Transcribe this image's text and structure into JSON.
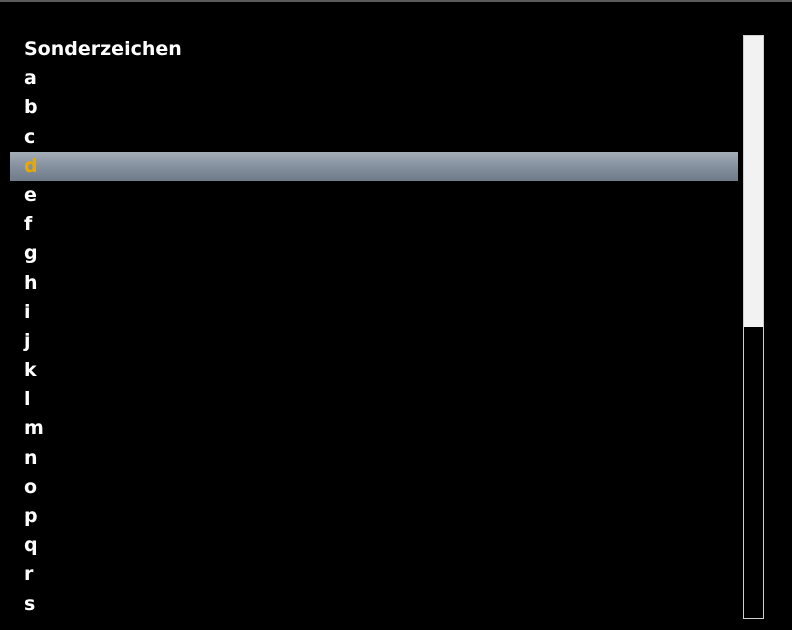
{
  "list": {
    "items": [
      {
        "label": "Sonderzeichen"
      },
      {
        "label": "a"
      },
      {
        "label": "b"
      },
      {
        "label": "c"
      },
      {
        "label": "d"
      },
      {
        "label": "e"
      },
      {
        "label": "f"
      },
      {
        "label": "g"
      },
      {
        "label": "h"
      },
      {
        "label": "i"
      },
      {
        "label": "j"
      },
      {
        "label": "k"
      },
      {
        "label": "l"
      },
      {
        "label": "m"
      },
      {
        "label": "n"
      },
      {
        "label": "o"
      },
      {
        "label": "p"
      },
      {
        "label": "q"
      },
      {
        "label": "r"
      },
      {
        "label": "s"
      }
    ],
    "selected_index": 4
  },
  "scrollbar": {
    "visible_fraction": 0.5,
    "scroll_position": 0
  },
  "colors": {
    "background": "#000000",
    "text": "#ffffff",
    "selected_text": "#e8a800",
    "selection_bar": "#8793a0",
    "scrollbar_thumb": "#f2f2f2"
  }
}
